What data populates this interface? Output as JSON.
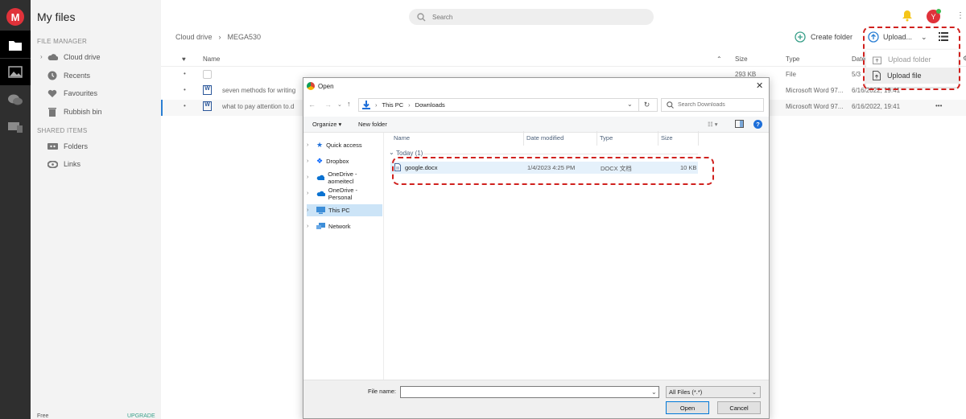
{
  "app": {
    "logo_letter": "M",
    "title": "My files",
    "search_placeholder": "Search",
    "avatar_letter": "Y"
  },
  "sidebar": {
    "section_file_manager": "FILE MANAGER",
    "items": [
      {
        "label": "Cloud drive",
        "icon": "cloud-icon"
      },
      {
        "label": "Recents",
        "icon": "clock-icon"
      },
      {
        "label": "Favourites",
        "icon": "heart-icon"
      },
      {
        "label": "Rubbish bin",
        "icon": "trash-icon"
      }
    ],
    "section_shared": "SHARED ITEMS",
    "shared_items": [
      {
        "label": "Folders",
        "icon": "shared-folders-icon"
      },
      {
        "label": "Links",
        "icon": "link-icon"
      }
    ],
    "footer_left": "Free",
    "footer_right": "UPGRADE"
  },
  "breadcrumb": {
    "root": "Cloud drive",
    "sep": "›",
    "current": "MEGA530"
  },
  "actions": {
    "create_folder": "Create folder",
    "upload": "Upload..."
  },
  "upload_menu": {
    "upload_folder": "Upload folder",
    "upload_file": "Upload file"
  },
  "table": {
    "headers": {
      "name": "Name",
      "size": "Size",
      "type": "Type",
      "date": "Date"
    },
    "rows": [
      {
        "name": "",
        "size": "293 KB",
        "type": "File",
        "date": "5/3"
      },
      {
        "name": "seven methods for writing",
        "size": "",
        "type": "Microsoft Word 97...",
        "date": "6/16/2022, 19:41"
      },
      {
        "name": "what to pay attention to.d",
        "size": "",
        "type": "Microsoft Word 97...",
        "date": "6/16/2022, 19:41",
        "more": "•••"
      }
    ]
  },
  "dialog": {
    "title": "Open",
    "close": "✕",
    "address": [
      "This PC",
      "Downloads"
    ],
    "search_placeholder": "Search Downloads",
    "organize": "Organize ▾",
    "new_folder": "New folder",
    "help": "?",
    "nav": [
      {
        "label": "Quick access",
        "icon": "star-icon",
        "color": "#1e6fd9"
      },
      {
        "label": "Dropbox",
        "icon": "dropbox-icon",
        "color": "#0061fe"
      },
      {
        "label": "OneDrive - aomeitecl",
        "icon": "onedrive-icon",
        "color": "#0a72d1"
      },
      {
        "label": "OneDrive - Personal",
        "icon": "onedrive-icon",
        "color": "#0a72d1"
      },
      {
        "label": "This PC",
        "icon": "computer-icon",
        "color": "#3d8ed8"
      },
      {
        "label": "Network",
        "icon": "network-icon",
        "color": "#3d8ed8"
      }
    ],
    "columns": {
      "name": "Name",
      "date": "Date modified",
      "type": "Type",
      "size": "Size"
    },
    "group_label": "Today (1)",
    "file": {
      "name": "google.docx",
      "date": "1/4/2023 4:25 PM",
      "type": "DOCX 文档",
      "size": "10 KB"
    },
    "file_name_label": "File name:",
    "file_type": "All Files (*.*)",
    "open": "Open",
    "cancel": "Cancel"
  },
  "colors": {
    "accent_red": "#d0211e",
    "mega_red": "#e0323a",
    "upgrade_green": "#3aa08a"
  }
}
